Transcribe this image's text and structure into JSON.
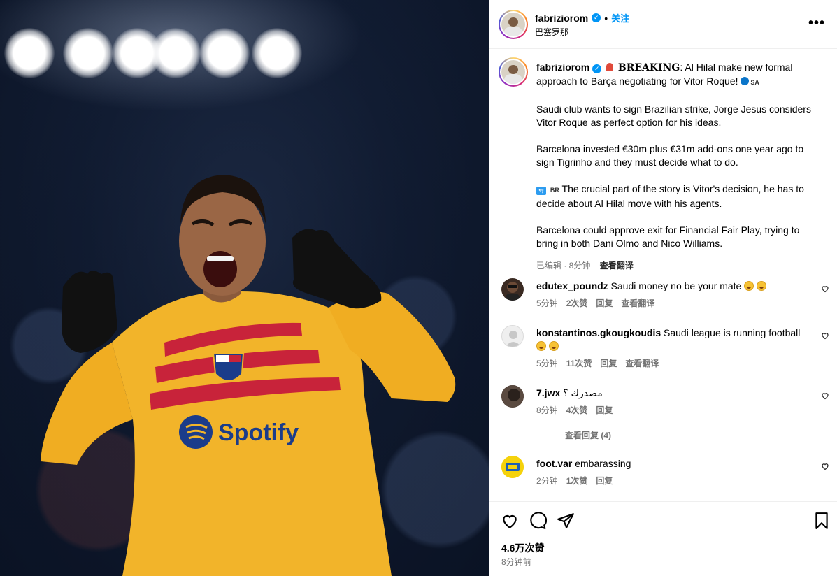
{
  "post": {
    "username": "fabriziorom",
    "follow_label": "关注",
    "location": "巴塞罗那",
    "more_label": "•••"
  },
  "caption": {
    "username": "fabriziorom",
    "breaking": "BREAKING",
    "line1": ": Al Hilal make new formal approach to Barça negotiating for Vitor Roque!",
    "line1_flag": "SA",
    "para2": "Saudi club wants to sign Brazilian strike, Jorge Jesus considers Vitor Roque as perfect option for his ideas.",
    "para3": "Barcelona invested €30m plus €31m add-ons one year ago to sign Tigrinho and they must decide what to do.",
    "para4_flag": "BR",
    "para4": " The crucial part of the story is Vitor's decision, he has to decide about Al Hilal move with his agents.",
    "para5": "Barcelona could approve exit for Financial Fair Play, trying to bring in both Dani Olmo and Nico Williams.",
    "meta": "已编辑 · 8分钟",
    "translate": "查看翻译"
  },
  "comments": [
    {
      "username": "edutex_poundz",
      "text": " Saudi money no be your mate",
      "time": "5分钟",
      "likes": "2次赞",
      "reply": "回复",
      "translate": "查看翻译"
    },
    {
      "username": "konstantinos.gkougkoudis",
      "text": " Saudi league is running football",
      "time": "5分钟",
      "likes": "11次赞",
      "reply": "回复",
      "translate": "查看翻译"
    },
    {
      "username": "7.jwx",
      "text": " مصدرك ؟",
      "time": "8分钟",
      "likes": "4次赞",
      "reply": "回复"
    },
    {
      "username": "foot.var",
      "text": " embarassing",
      "time": "2分钟",
      "likes": "1次赞",
      "reply": "回复"
    }
  ],
  "view_replies": "查看回复 (4)",
  "footer": {
    "likes": "4.6万次赞",
    "time": "8分钟前"
  },
  "jersey": {
    "sponsor": "Spotify"
  },
  "colors": {
    "accent": "#0095f6",
    "muted": "#737373",
    "jersey_yellow": "#f2b42a",
    "jersey_red": "#c8233a"
  }
}
